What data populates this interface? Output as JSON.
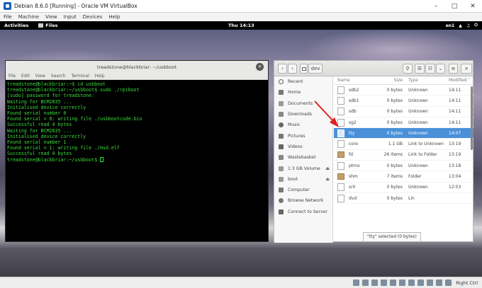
{
  "vbox": {
    "title": "Debian 8.6.0 [Running] - Oracle VM VirtualBox",
    "menu": [
      "File",
      "Machine",
      "View",
      "Input",
      "Devices",
      "Help"
    ],
    "host_key": "Right Ctrl"
  },
  "topbar": {
    "activities": "Activities",
    "app": "Files",
    "clock": "Thu 14:13",
    "lang": "en1"
  },
  "terminal": {
    "title": "treadstone@blackbriar: ~/usbboot",
    "menu": [
      "File",
      "Edit",
      "View",
      "Search",
      "Terminal",
      "Help"
    ],
    "lines": [
      "treadstone@blackbriar:~$ cd usbboot",
      "treadstone@blackbriar:~/usbboot$ sudo ./rpiboot",
      "[sudo] password for treadstone:",
      "Waiting for BCM2835 ...",
      "Initialised device correctly",
      "Found serial number 0",
      "Found serial = 0: writing file ./usbbootcode.bin",
      "Successful read 4 bytes",
      "Waiting for BCM2835 ...",
      "Initialised device correctly",
      "Found serial number 1",
      "Found serial = 1: writing file ./msd.elf",
      "Successful read 4 bytes",
      "treadstone@blackbriar:~/usbboot$ "
    ]
  },
  "files": {
    "path": "dev",
    "search_text": "dev",
    "filter": "All Files",
    "sidebar": [
      {
        "label": "Recent",
        "icon": "clock-icon"
      },
      {
        "label": "Home",
        "icon": "home-icon"
      },
      {
        "label": "Documents",
        "icon": "documents-icon"
      },
      {
        "label": "Downloads",
        "icon": "downloads-icon"
      },
      {
        "label": "Music",
        "icon": "music-icon"
      },
      {
        "label": "Pictures",
        "icon": "pictures-icon"
      },
      {
        "label": "Videos",
        "icon": "videos-icon"
      },
      {
        "label": "Wastebasket",
        "icon": "trash-icon"
      },
      {
        "label": "1.3 GB Volume",
        "icon": "drive-icon"
      },
      {
        "label": "boot",
        "icon": "drive-icon"
      },
      {
        "label": "Computer",
        "icon": "computer-icon"
      },
      {
        "label": "Browse Network",
        "icon": "network-icon"
      },
      {
        "label": "Connect to Server",
        "icon": "server-icon"
      }
    ],
    "columns": [
      "Name",
      "Size",
      "Type",
      "Modified"
    ],
    "rows": [
      [
        "sdb2",
        "0 bytes",
        "Unknown",
        "14:11"
      ],
      [
        "sdb1",
        "0 bytes",
        "Unknown",
        "14:11"
      ],
      [
        "sdb",
        "0 bytes",
        "Unknown",
        "14:11"
      ],
      [
        "sg2",
        "0 bytes",
        "Unknown",
        "14:11"
      ],
      [
        "tty",
        "0 bytes",
        "Unknown",
        "14:07"
      ],
      [
        "core",
        "1.1 GB",
        "Link to Unknown",
        "13:19"
      ],
      [
        "fd",
        "26 items",
        "Link to Folder",
        "13:19"
      ],
      [
        "ptmx",
        "0 bytes",
        "Unknown",
        "13:18"
      ],
      [
        "shm",
        "7 items",
        "Folder",
        "13:04"
      ],
      [
        "sr0",
        "0 bytes",
        "Unknown",
        "12:03"
      ],
      [
        "dvd",
        "0 bytes",
        "Lin",
        ""
      ]
    ],
    "status": "\"tty\" selected (0 bytes)"
  }
}
